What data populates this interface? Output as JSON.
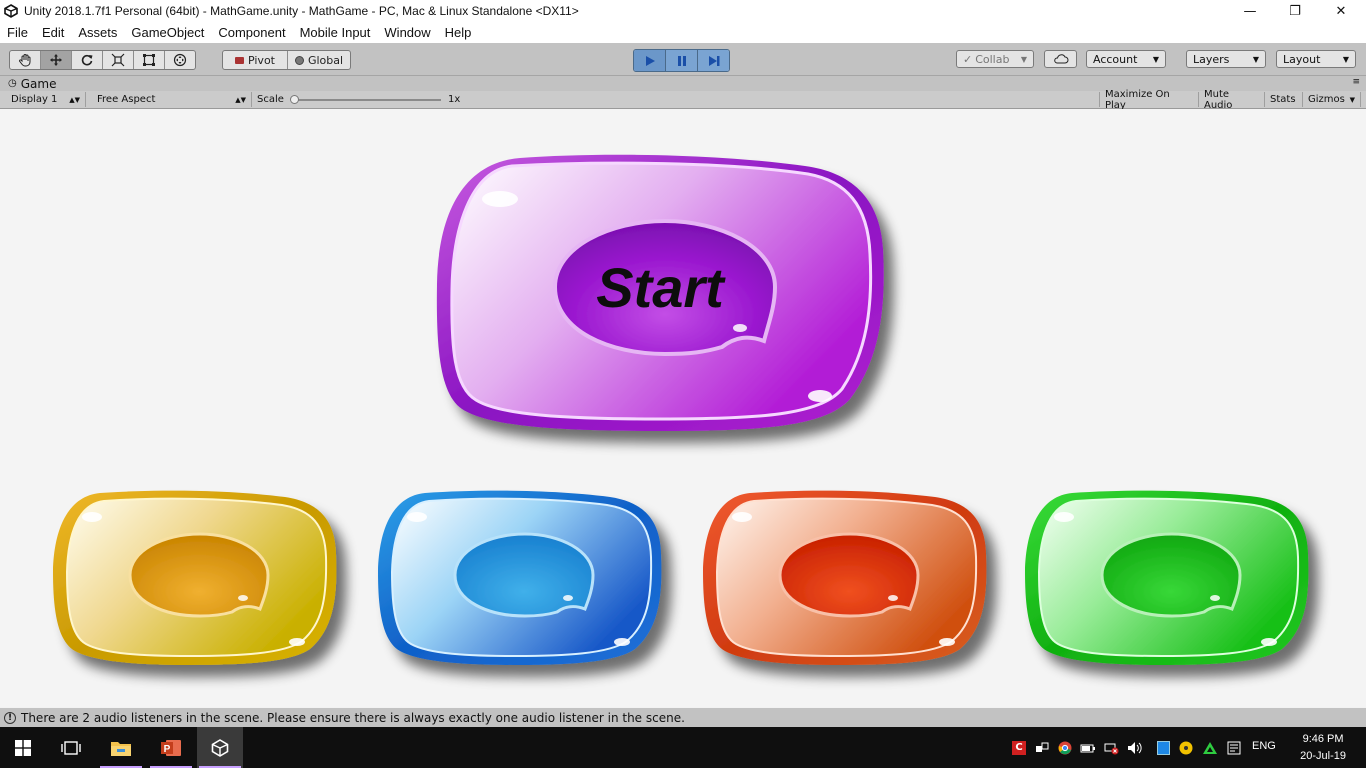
{
  "window": {
    "title": "Unity 2018.1.7f1 Personal (64bit) - MathGame.unity - MathGame - PC, Mac & Linux Standalone <DX11>",
    "controls": [
      "minimize-icon",
      "restore-icon",
      "close-icon"
    ]
  },
  "menu": [
    "File",
    "Edit",
    "Assets",
    "GameObject",
    "Component",
    "Mobile Input",
    "Window",
    "Help"
  ],
  "toolbar": {
    "tools": [
      "hand-icon",
      "move-icon",
      "rotate-icon",
      "scale-icon",
      "rect-icon",
      "transform-icon"
    ],
    "active_tool": "move-icon",
    "pivot_label": "Pivot",
    "global_label": "Global",
    "play_controls": [
      "play-icon",
      "pause-icon",
      "step-icon"
    ],
    "collab_label": "Collab",
    "account_label": "Account",
    "layers_label": "Layers",
    "layout_label": "Layout"
  },
  "game_panel": {
    "tab_label": "Game",
    "display_label": "Display 1",
    "aspect_label": "Free Aspect",
    "scale_label": "Scale",
    "scale_value": "1x",
    "maximize_label": "Maximize On Play",
    "mute_label": "Mute Audio",
    "stats_label": "Stats",
    "gizmos_label": "Gizmos"
  },
  "scene": {
    "start_label": "Start",
    "buttons": [
      {
        "color": "yellow"
      },
      {
        "color": "blue"
      },
      {
        "color": "red"
      },
      {
        "color": "green"
      }
    ]
  },
  "status": {
    "message": "There are 2 audio listeners in the scene. Please ensure there is always exactly one audio listener in the scene."
  },
  "taskbar": {
    "apps": [
      "windows-start-icon",
      "task-view-icon",
      "file-explorer-icon",
      "powerpoint-icon",
      "unity-icon"
    ],
    "language": "ENG",
    "time": "9:46 PM",
    "date": "20-Jul-19"
  }
}
